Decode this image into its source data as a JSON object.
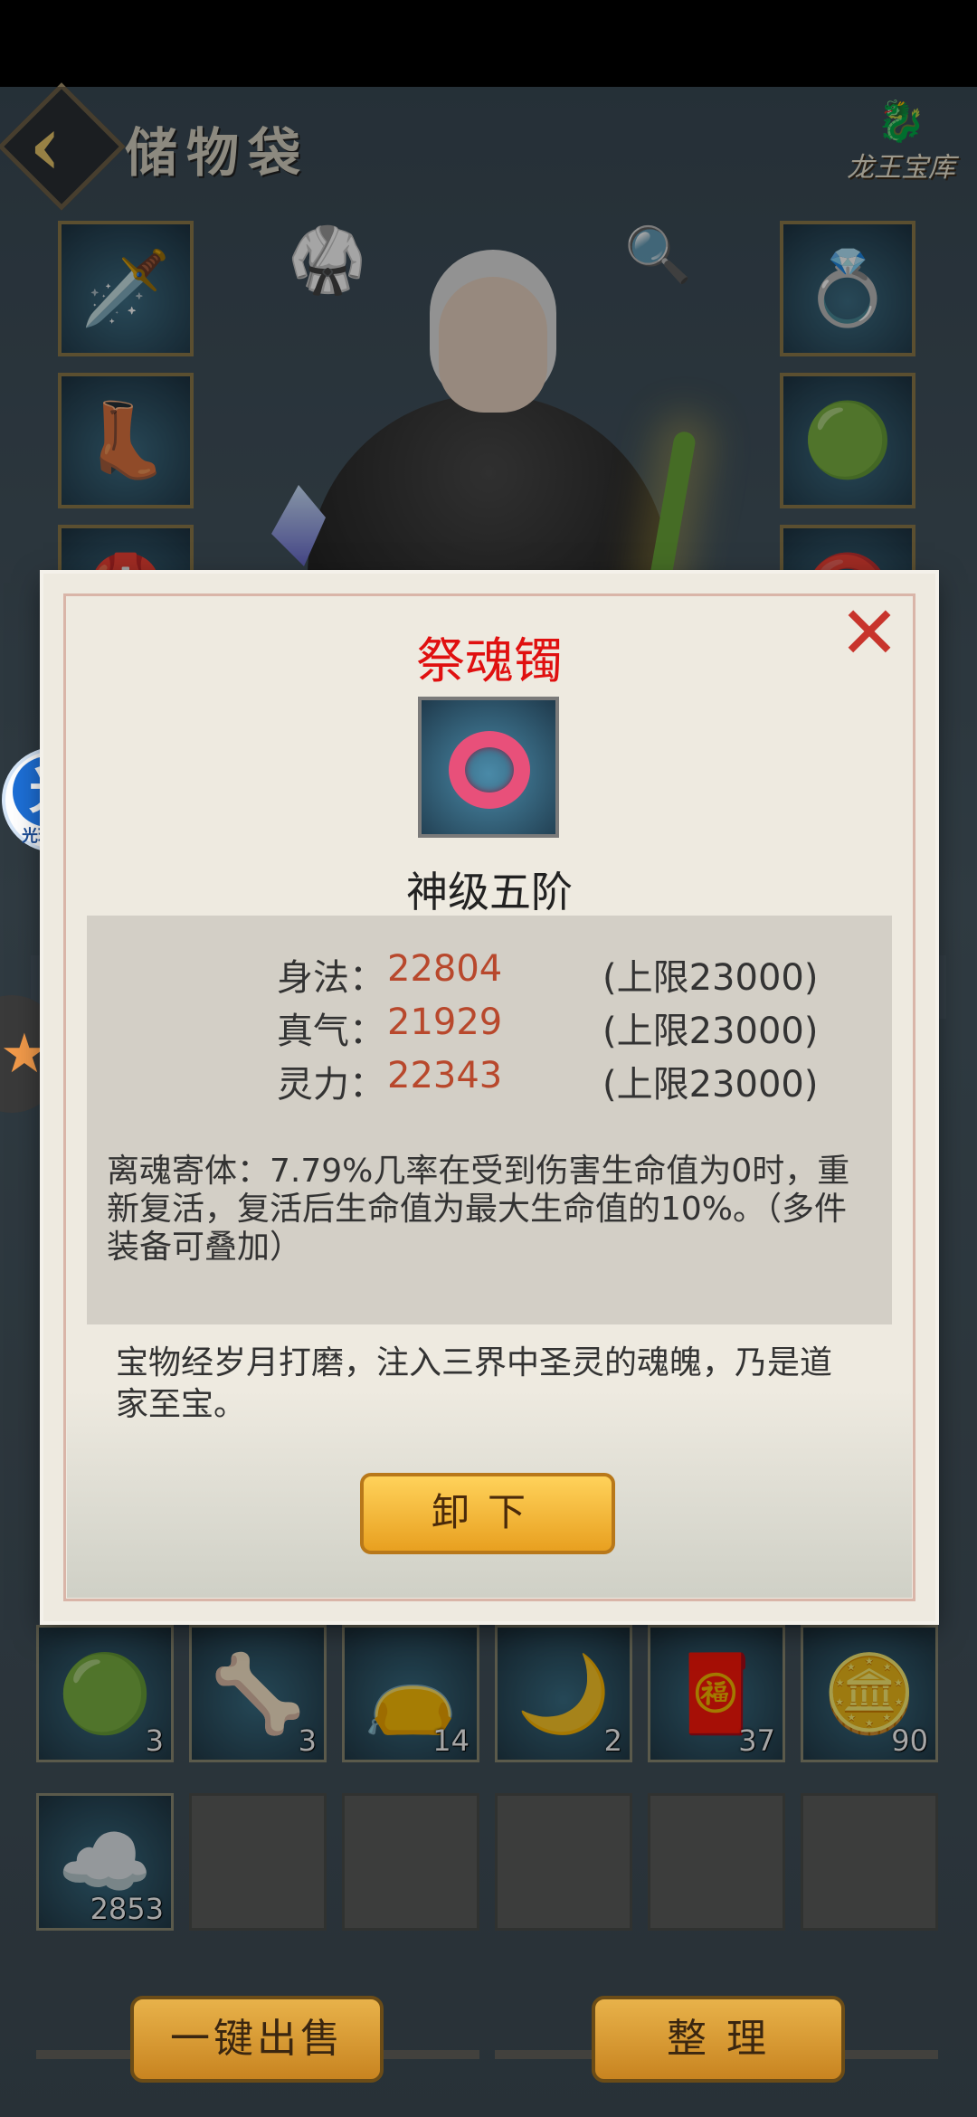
{
  "header": {
    "title": "储物袋",
    "vault_label": "龙王宝库"
  },
  "equipment": {
    "left_slots": [
      "sword-icon",
      "boots-icon",
      "helmet-icon"
    ],
    "right_slots": [
      "ring-icon",
      "jade-pendant-icon",
      "bracelet-icon"
    ]
  },
  "assistant": {
    "label": "光环助手",
    "glyph": "光"
  },
  "modal": {
    "item_name": "祭魂镯",
    "grade": "神级五阶",
    "stats": [
      {
        "name": "身法：",
        "value": "22804",
        "cap": "(上限23000)"
      },
      {
        "name": "真气：",
        "value": "21929",
        "cap": "(上限23000)"
      },
      {
        "name": "灵力：",
        "value": "22343",
        "cap": "(上限23000)"
      }
    ],
    "effect": "离魂寄体：7.79%几率在受到伤害生命值为0时，重新复活，复活后生命值为最大生命值的10%。（多件装备可叠加）",
    "lore": "宝物经岁月打磨，注入三界中圣灵的魂魄，乃是道家至宝。",
    "unequip_label": "卸下",
    "close_glyph": "✕"
  },
  "inventory": [
    {
      "icon": "green-orb-icon",
      "count": "3"
    },
    {
      "icon": "bone-talisman-icon",
      "count": "3"
    },
    {
      "icon": "purple-pouch-icon",
      "count": "14"
    },
    {
      "icon": "horn-icon",
      "count": "2"
    },
    {
      "icon": "red-knot-icon",
      "count": "37"
    },
    {
      "icon": "coin-icon",
      "count": "90"
    },
    {
      "icon": "cloud-jade-icon",
      "count": "2853"
    }
  ],
  "footer": {
    "sell_all_label": "一键出售",
    "sort_label": "整 理"
  }
}
